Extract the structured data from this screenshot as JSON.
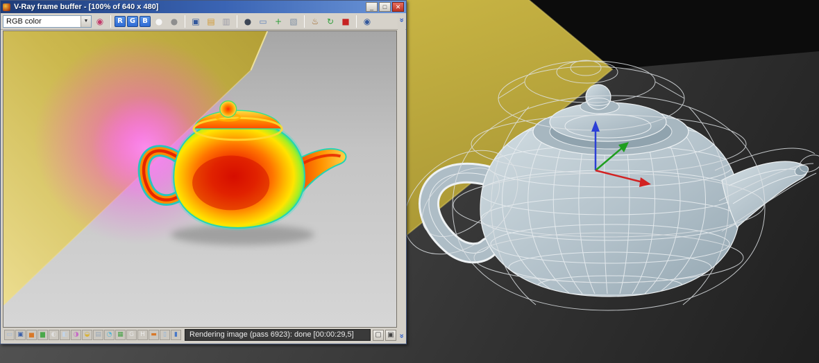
{
  "colors": {
    "titlebar_blue": "#3a64b4",
    "wall_yellow": "#c6b144",
    "glow_magenta": "#ff46eb",
    "thermal_hot": "#dc0f00",
    "thermal_cold": "#14ccc8",
    "viewport_background": "#3c3c3c",
    "gizmo_x": "#d22222",
    "gizmo_y": "#1f9e1f",
    "gizmo_z": "#2b3fd6"
  },
  "vfb_window": {
    "title": "V-Ray frame buffer - [100% of 640 x 480]",
    "titlebar_buttons": {
      "minimize": "_",
      "maximize": "□",
      "close": "✕"
    },
    "channel_dropdown": {
      "value": "RGB color",
      "arrow": "▼"
    },
    "toolbar": {
      "icons": [
        {
          "name": "color-corrections-icon",
          "glyph": "◉",
          "color": "#c23a6a"
        },
        {
          "sep": true
        },
        {
          "name": "red-channel-button",
          "label": "R",
          "bg": "#2e6bd4",
          "color": "#ffffff"
        },
        {
          "name": "green-channel-button",
          "label": "G",
          "bg": "#2e6bd4",
          "color": "#ffffff"
        },
        {
          "name": "blue-channel-button",
          "label": "B",
          "bg": "#2e6bd4",
          "color": "#ffffff"
        },
        {
          "name": "alpha-channel-button",
          "glyph": "●",
          "color": "#f6f6f6"
        },
        {
          "name": "monochrome-button",
          "glyph": "●",
          "color": "#8e8e8e"
        },
        {
          "sep": true
        },
        {
          "name": "save-image-button",
          "glyph": "▣",
          "color": "#33589c"
        },
        {
          "name": "load-image-button",
          "glyph": "▤",
          "color": "#d09a36"
        },
        {
          "name": "copy-image-button",
          "glyph": "▥",
          "color": "#9a9aa6"
        },
        {
          "sep": true
        },
        {
          "name": "follow-mouse-button",
          "glyph": "●",
          "color": "#3c4656"
        },
        {
          "name": "duplicate-to-host-button",
          "glyph": "▭",
          "color": "#5f82b8"
        },
        {
          "name": "track-mouse-button",
          "glyph": "+",
          "color": "#2f9e3a"
        },
        {
          "name": "region-render-button",
          "glyph": "▧",
          "color": "#7d8ea2"
        },
        {
          "sep": true
        },
        {
          "name": "render-last-button",
          "glyph": "♨",
          "color": "#a06a30"
        },
        {
          "name": "refresh-button",
          "glyph": "↻",
          "color": "#2f9e3a"
        },
        {
          "name": "stop-button",
          "glyph": "■",
          "color": "#c62222"
        },
        {
          "sep": true
        },
        {
          "name": "view-options-button",
          "glyph": "◉",
          "color": "#33589c"
        }
      ]
    },
    "statusbar": {
      "icons": [
        {
          "name": "preview-monitor-icon",
          "glyph": "▭",
          "color": "#9db9dd"
        },
        {
          "name": "save-channels-icon",
          "glyph": "▣",
          "color": "#3a5fa8"
        },
        {
          "name": "histogram-icon",
          "glyph": "▅",
          "color": "#d87828"
        },
        {
          "name": "waveform-icon",
          "glyph": "▆",
          "color": "#4aa84a"
        },
        {
          "name": "exposure-icon",
          "glyph": "◐",
          "color": "#e0e0e0"
        },
        {
          "name": "white-balance-icon",
          "glyph": "◧",
          "color": "#c2d4e8"
        },
        {
          "name": "hue-saturation-icon",
          "glyph": "◑",
          "color": "#c66ac6"
        },
        {
          "name": "color-balance-icon",
          "glyph": "◒",
          "color": "#d8b23a"
        },
        {
          "name": "levels-icon",
          "glyph": "▤",
          "color": "#9aa8b8"
        },
        {
          "name": "curves-icon",
          "glyph": "◔",
          "color": "#52b4d8"
        },
        {
          "name": "lut-icon",
          "glyph": "▦",
          "color": "#48a048"
        },
        {
          "name": "srgb-icon",
          "glyph": "G",
          "color": "#e6e6e6"
        },
        {
          "name": "letter-h-icon",
          "glyph": "H",
          "color": "#ececec"
        },
        {
          "name": "stamp-icon",
          "glyph": "▬",
          "color": "#d87828"
        },
        {
          "name": "region-overlay-icon",
          "glyph": "▯",
          "color": "#8ab4e0"
        },
        {
          "name": "compare-icon",
          "glyph": "▮",
          "color": "#4878c8"
        }
      ],
      "status_text": "Rendering image (pass 6923): done [00:00:29,5]",
      "right_icons": [
        {
          "name": "show-region-button",
          "glyph": "▢",
          "color": "#444444"
        },
        {
          "name": "dock-button",
          "glyph": "▣",
          "color": "#444444"
        }
      ]
    },
    "scroll_chevrons": {
      "top": "»",
      "bottom": "»"
    }
  },
  "viewport": {
    "gizmo": {
      "x_color": "#d22222",
      "y_color": "#1f9e1f",
      "z_color": "#2b3fd6"
    },
    "wall_color": "#c6b144"
  }
}
